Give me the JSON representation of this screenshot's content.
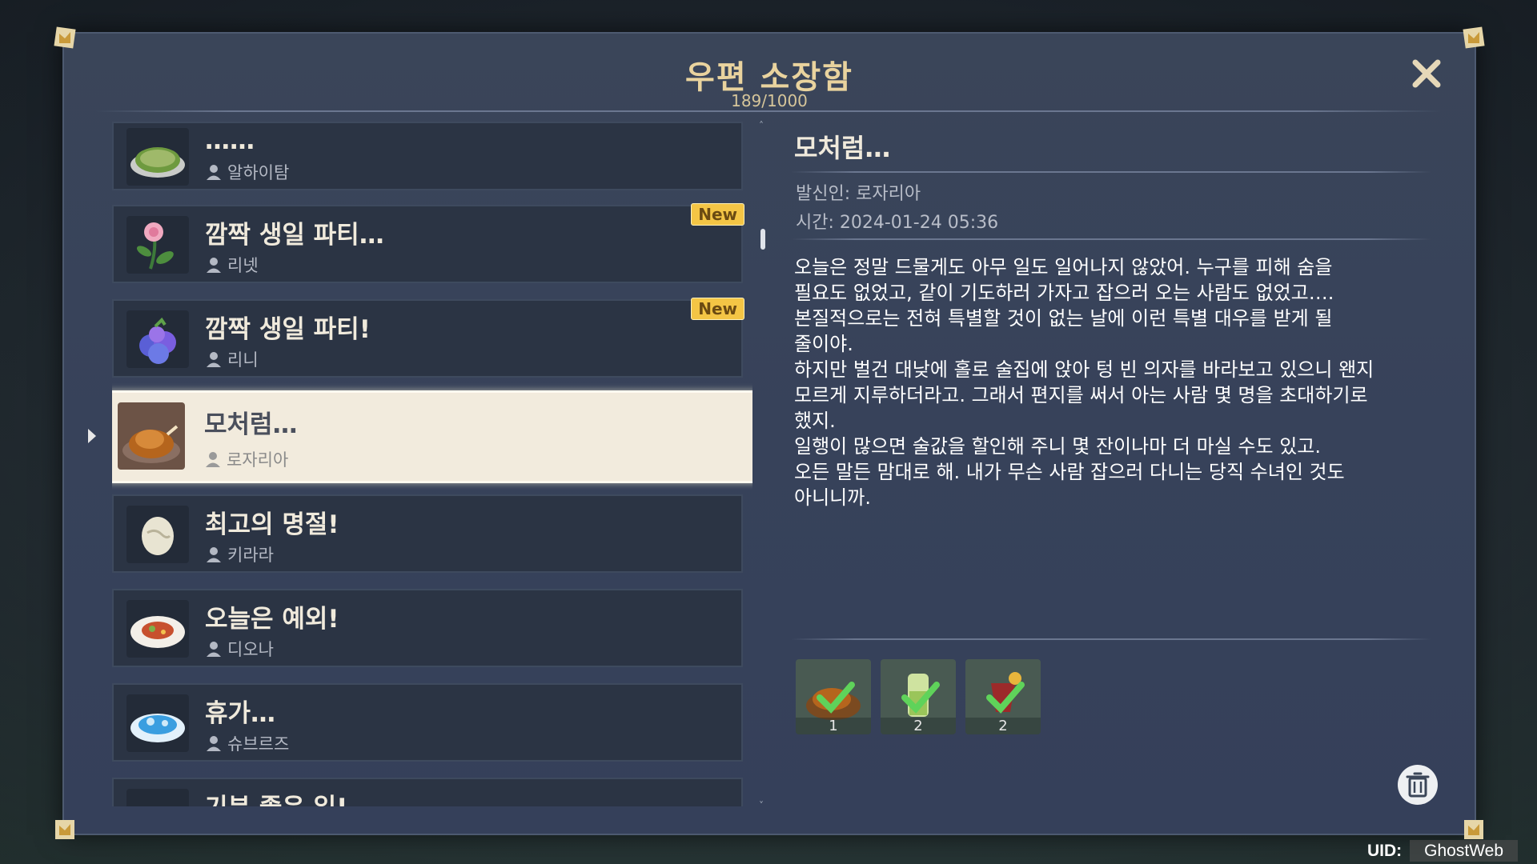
{
  "mailbox": {
    "title": "우편 소장함",
    "count": "189/1000",
    "new_badge": "New"
  },
  "mails": [
    {
      "subject": "……",
      "sender": "알하이탐",
      "is_new": false,
      "icon": "spinach-omelette-icon"
    },
    {
      "subject": "깜짝 생일 파티…",
      "sender": "리넷",
      "is_new": true,
      "icon": "rose-flower-icon"
    },
    {
      "subject": "깜짝 생일 파티!",
      "sender": "리니",
      "is_new": true,
      "icon": "purple-berries-icon"
    },
    {
      "subject": "모처럼…",
      "sender": "로자리아",
      "is_new": false,
      "icon": "roast-bird-icon",
      "selected": true
    },
    {
      "subject": "최고의 명절!",
      "sender": "키라라",
      "is_new": false,
      "icon": "egg-icon"
    },
    {
      "subject": "오늘은 예외!",
      "sender": "디오나",
      "is_new": false,
      "icon": "steak-plate-icon"
    },
    {
      "subject": "휴가…",
      "sender": "슈브르즈",
      "is_new": false,
      "icon": "blue-pudding-icon"
    },
    {
      "subject": "기분 좋은 일!",
      "sender": "",
      "is_new": false,
      "icon": "salad-icon"
    }
  ],
  "detail": {
    "title": "모처럼…",
    "sender_line": "발신인: 로자리아",
    "time_line": "시간: 2024-01-24 05:36",
    "body": "오늘은 정말 드물게도 아무 일도 일어나지 않았어. 누구를 피해 숨을\n필요도 없었고, 같이 기도하러 가자고 잡으러 오는 사람도 없었고….\n본질적으로는 전혀 특별할 것이 없는 날에 이런 특별 대우를 받게 될\n줄이야.\n하지만 벌건 대낮에 홀로 술집에 앉아 텅 빈 의자를 바라보고 있으니 왠지\n모르게 지루하더라고. 그래서 편지를 써서 아는 사람 몇 명을 초대하기로\n했지.\n일행이 많으면 술값을 할인해 주니 몇 잔이나마 더 마실 수도 있고.\n오든 말든 맘대로 해. 내가 무슨 사람 잡으러 다니는 당직 수녀인 것도\n아니니까.",
    "attachments": [
      {
        "icon": "roast-bird-icon",
        "qty": "1",
        "claimed": true
      },
      {
        "icon": "green-drink-icon",
        "qty": "2",
        "claimed": true
      },
      {
        "icon": "red-wine-icon",
        "qty": "2",
        "claimed": true
      }
    ]
  },
  "footer": {
    "uid_label": "UID:",
    "uid_value": "GhostWeb"
  },
  "colors": {
    "title_gold": "#e9d39e",
    "new_badge": "#f4c545",
    "selected_bg": "#f2ebdd",
    "item_bg": "#2b3444",
    "panel_bg": "#37425a"
  }
}
